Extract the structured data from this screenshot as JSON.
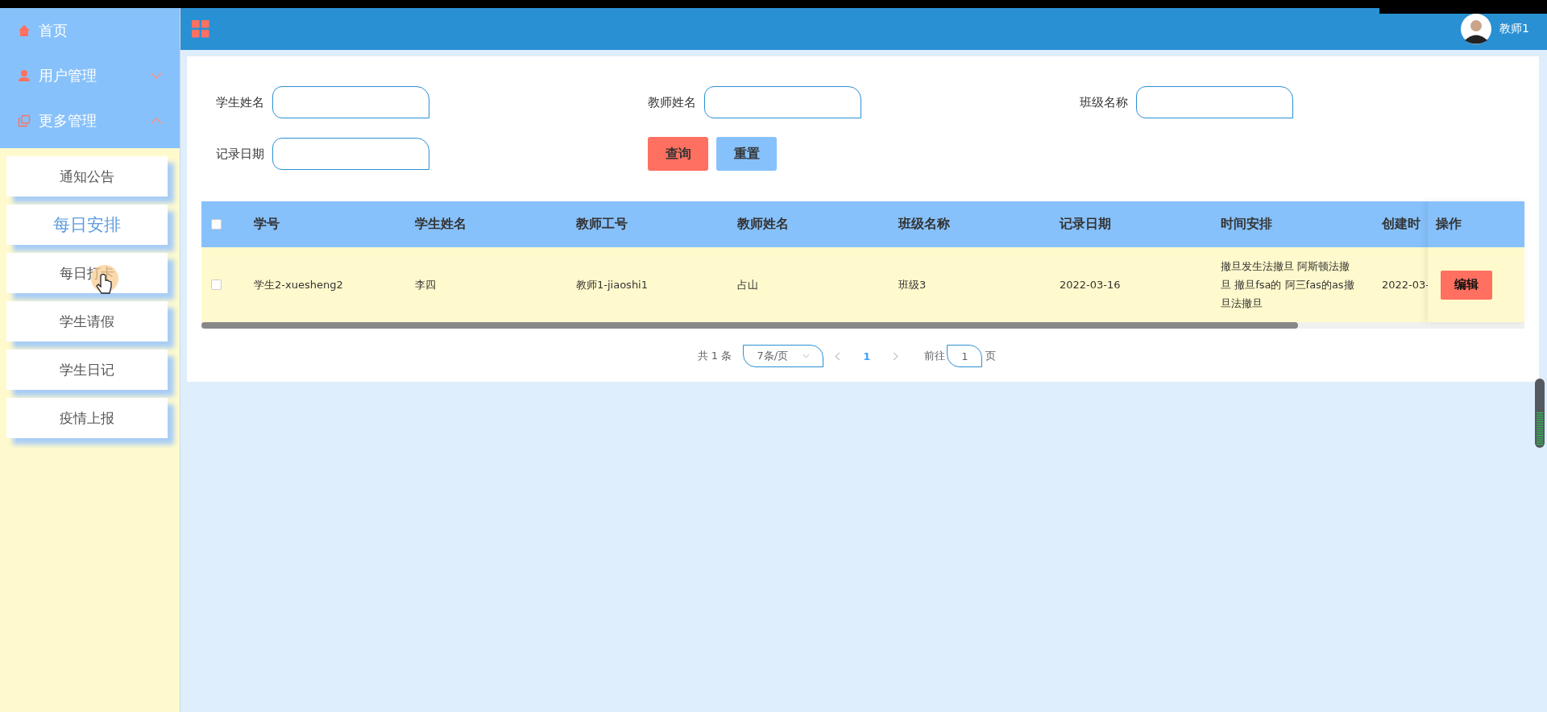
{
  "header": {
    "user_name": "教师1"
  },
  "sidebar": {
    "menu": [
      {
        "label": "首页",
        "kind": "link"
      },
      {
        "label": "用户管理",
        "kind": "group",
        "expanded": false
      },
      {
        "label": "更多管理",
        "kind": "group",
        "expanded": true,
        "children": [
          {
            "label": "通知公告",
            "selected": false,
            "hovered": false
          },
          {
            "label": "每日安排",
            "selected": true,
            "hovered": false
          },
          {
            "label": "每日打卡",
            "selected": false,
            "hovered": true
          },
          {
            "label": "学生请假",
            "selected": false,
            "hovered": false
          },
          {
            "label": "学生日记",
            "selected": false,
            "hovered": false
          },
          {
            "label": "疫情上报",
            "selected": false,
            "hovered": false
          }
        ]
      }
    ]
  },
  "search_form": {
    "fields": [
      {
        "label": "学生姓名"
      },
      {
        "label": "教师姓名"
      },
      {
        "label": "班级名称"
      },
      {
        "label": "记录日期"
      }
    ],
    "buttons": [
      {
        "label": "查询",
        "kind": "primary"
      },
      {
        "label": "重置",
        "kind": "secondary"
      }
    ]
  },
  "table": {
    "all_checked": false,
    "columns": [
      "学号",
      "学生姓名",
      "教师工号",
      "教师姓名",
      "班级名称",
      "记录日期",
      "时间安排",
      "创建时",
      "操作"
    ],
    "rows": [
      {
        "checked": false,
        "cells": [
          "学生2-xuesheng2",
          "李四",
          "教师1-jiaoshi1",
          "占山",
          "班级3",
          "2022-03-16",
          "撤旦发生法撤旦 阿斯顿法撤旦 撤旦fsa的 阿三fas的as撤旦法撤旦",
          "2022-03-"
        ],
        "action": "编辑"
      }
    ]
  },
  "pagination": {
    "total": "共 1 条",
    "page_size": "7条/页",
    "pages": [
      {
        "label": "1",
        "selected": true
      }
    ],
    "goto_label": "前往",
    "goto_value": "1",
    "goto_suffix": "页"
  }
}
